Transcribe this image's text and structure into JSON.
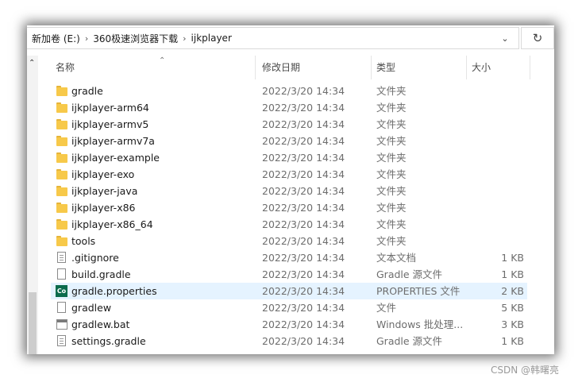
{
  "address": {
    "crumbs": [
      "新加卷 (E:)",
      "360极速浏览器下载",
      "ijkplayer"
    ],
    "separator": "›",
    "dropdown_glyph": "⌄",
    "refresh_glyph": "↻"
  },
  "columns": {
    "name": "名称",
    "date": "修改日期",
    "type": "类型",
    "size": "大小"
  },
  "rows": [
    {
      "icon": "folder",
      "name": "gradle",
      "date": "2022/3/20 14:34",
      "type": "文件夹",
      "size": ""
    },
    {
      "icon": "folder",
      "name": "ijkplayer-arm64",
      "date": "2022/3/20 14:34",
      "type": "文件夹",
      "size": ""
    },
    {
      "icon": "folder",
      "name": "ijkplayer-armv5",
      "date": "2022/3/20 14:34",
      "type": "文件夹",
      "size": ""
    },
    {
      "icon": "folder",
      "name": "ijkplayer-armv7a",
      "date": "2022/3/20 14:34",
      "type": "文件夹",
      "size": ""
    },
    {
      "icon": "folder",
      "name": "ijkplayer-example",
      "date": "2022/3/20 14:34",
      "type": "文件夹",
      "size": ""
    },
    {
      "icon": "folder",
      "name": "ijkplayer-exo",
      "date": "2022/3/20 14:34",
      "type": "文件夹",
      "size": ""
    },
    {
      "icon": "folder",
      "name": "ijkplayer-java",
      "date": "2022/3/20 14:34",
      "type": "文件夹",
      "size": ""
    },
    {
      "icon": "folder",
      "name": "ijkplayer-x86",
      "date": "2022/3/20 14:34",
      "type": "文件夹",
      "size": ""
    },
    {
      "icon": "folder",
      "name": "ijkplayer-x86_64",
      "date": "2022/3/20 14:34",
      "type": "文件夹",
      "size": ""
    },
    {
      "icon": "folder",
      "name": "tools",
      "date": "2022/3/20 14:34",
      "type": "文件夹",
      "size": ""
    },
    {
      "icon": "text-file",
      "name": ".gitignore",
      "date": "2022/3/20 14:34",
      "type": "文本文档",
      "size": "1 KB"
    },
    {
      "icon": "file",
      "name": "build.gradle",
      "date": "2022/3/20 14:34",
      "type": "Gradle 源文件",
      "size": "1 KB"
    },
    {
      "icon": "properties",
      "icon_text": "Co",
      "name": "gradle.properties",
      "date": "2022/3/20 14:34",
      "type": "PROPERTIES 文件",
      "size": "2 KB",
      "selected": true
    },
    {
      "icon": "file",
      "name": "gradlew",
      "date": "2022/3/20 14:34",
      "type": "文件",
      "size": "5 KB"
    },
    {
      "icon": "bat",
      "name": "gradlew.bat",
      "date": "2022/3/20 14:34",
      "type": "Windows 批处理...",
      "size": "3 KB"
    },
    {
      "icon": "text-file",
      "name": "settings.gradle",
      "date": "2022/3/20 14:34",
      "type": "Gradle 源文件",
      "size": "1 KB"
    }
  ],
  "watermark": "CSDN @韩曙亮",
  "colors": {
    "selection": "#e5f3ff",
    "folder": "#f7c94a",
    "properties_icon": "#0b6b4c"
  }
}
